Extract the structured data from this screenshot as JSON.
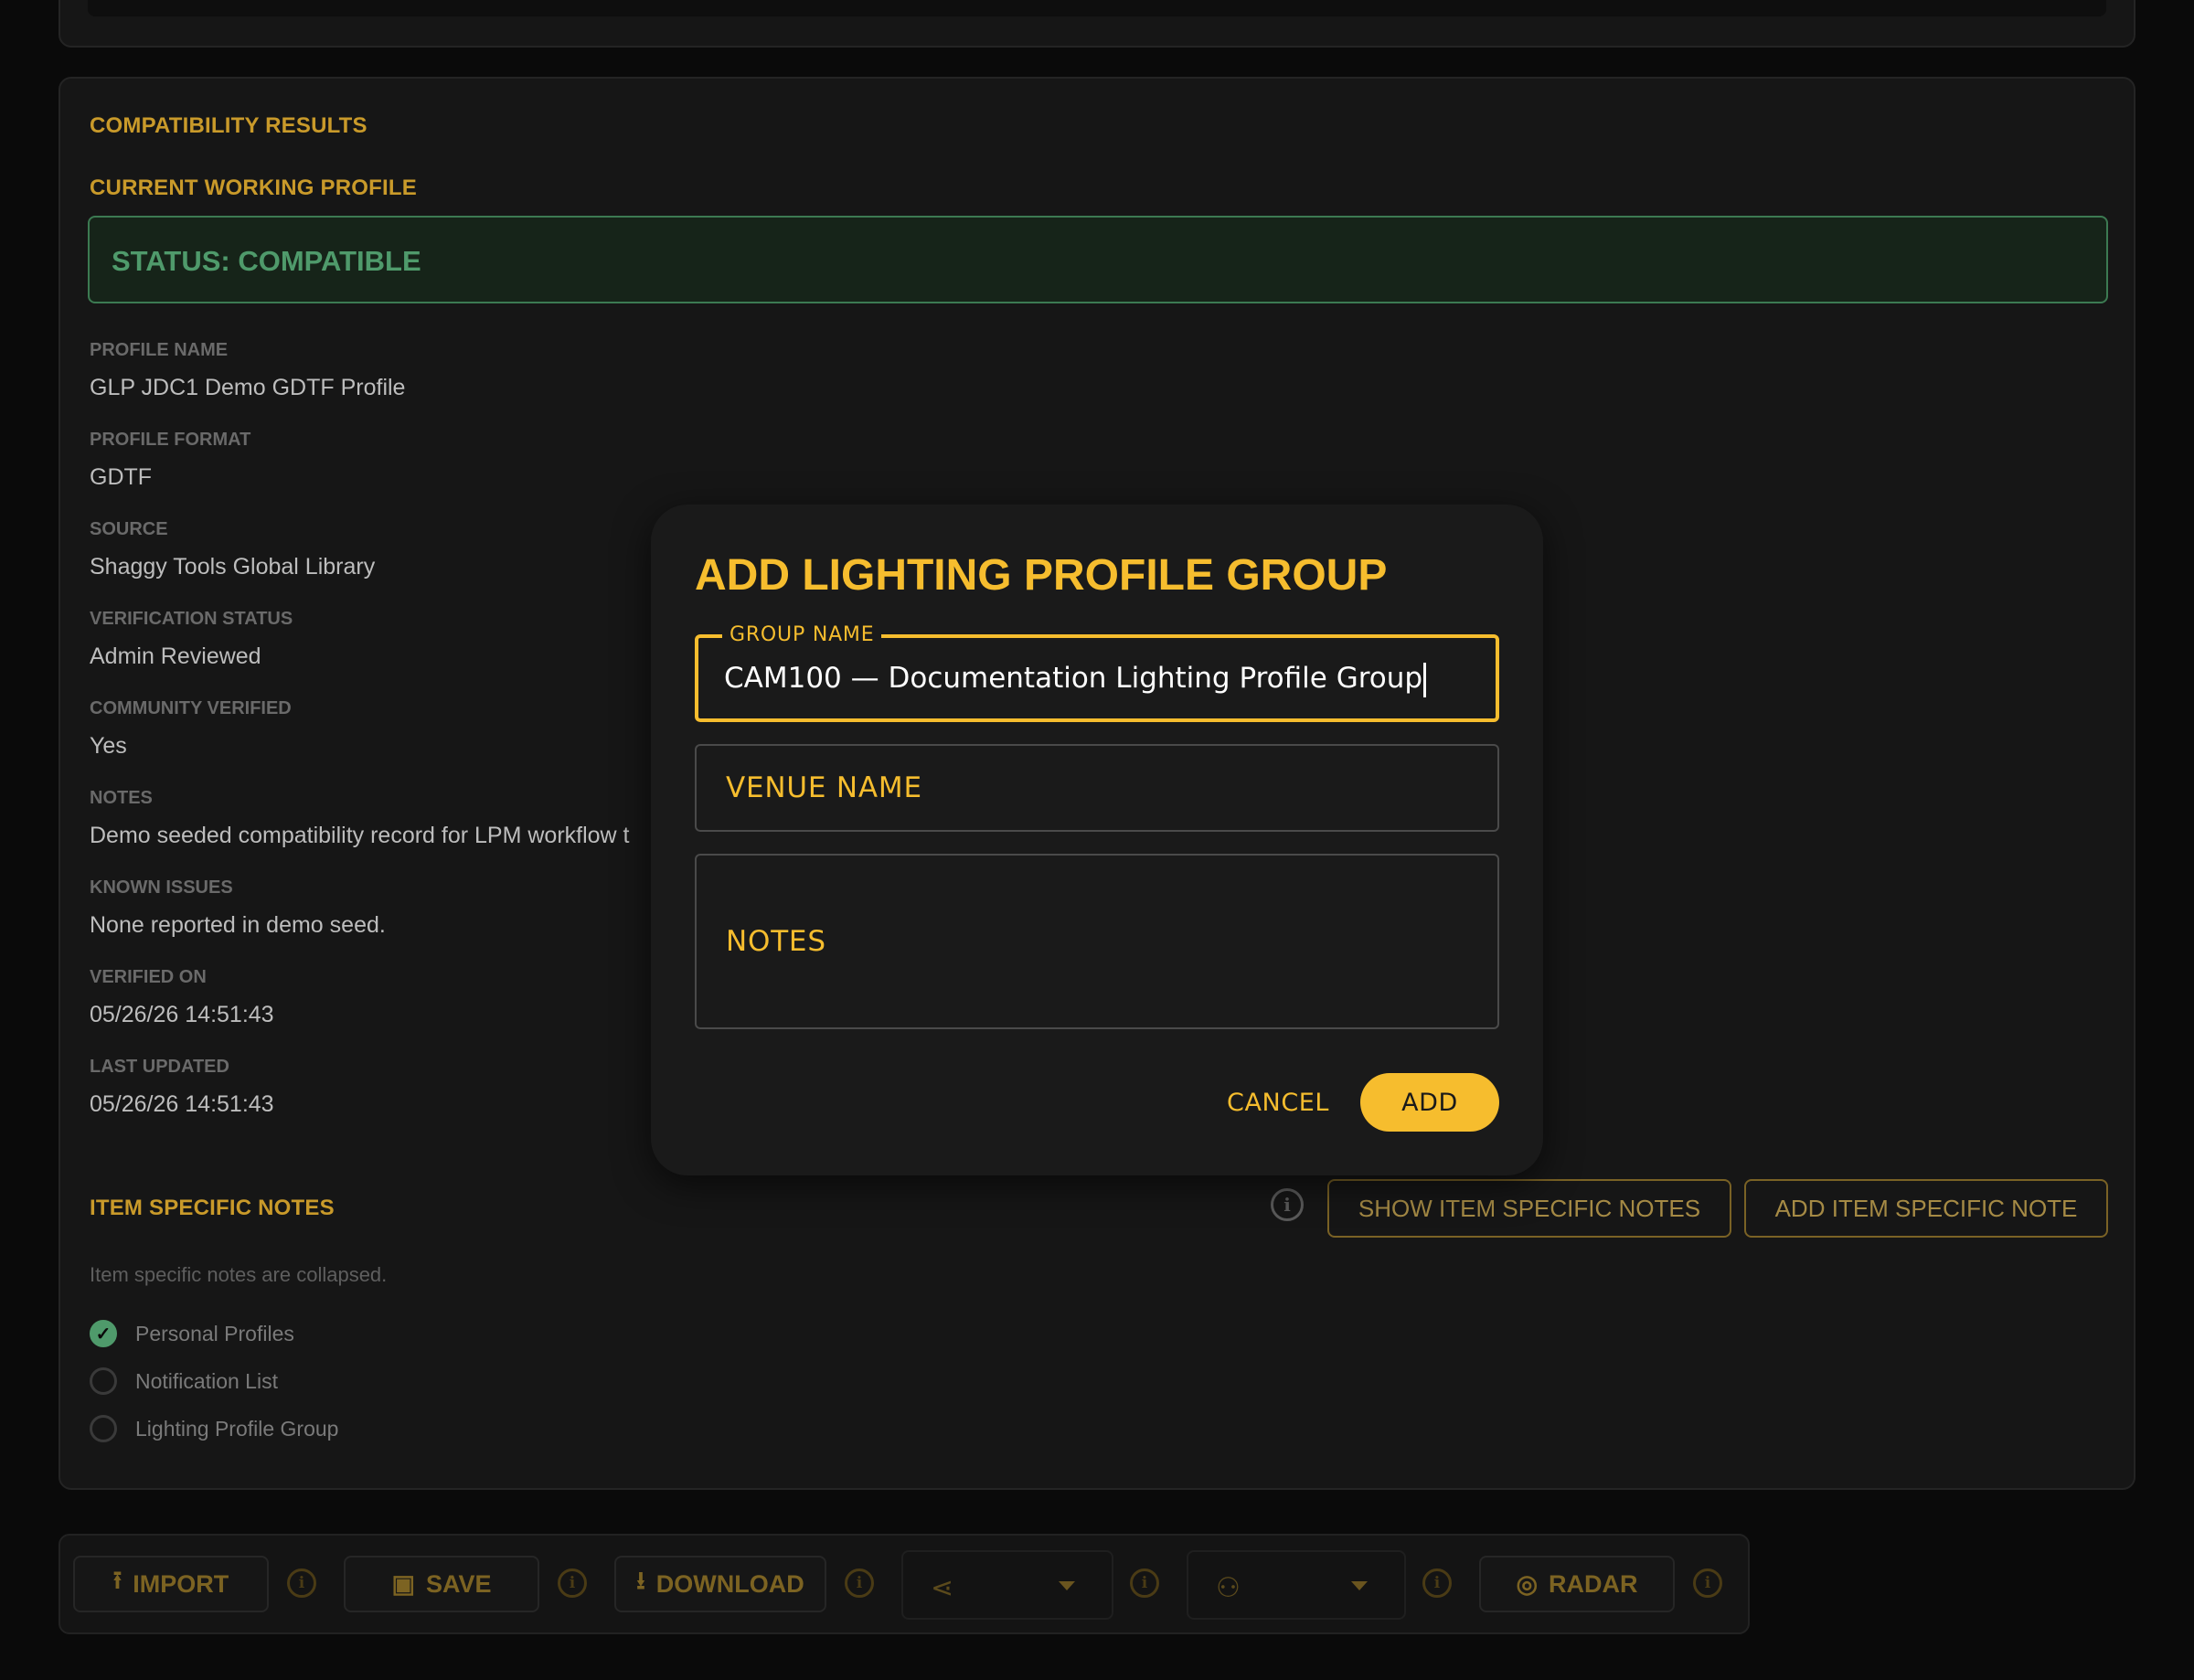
{
  "results": {
    "title": "COMPATIBILITY RESULTS",
    "working_profile_title": "CURRENT WORKING PROFILE",
    "status": "STATUS: COMPATIBLE",
    "fields": [
      {
        "label": "PROFILE NAME",
        "value": "GLP JDC1 Demo GDTF Profile"
      },
      {
        "label": "PROFILE FORMAT",
        "value": "GDTF"
      },
      {
        "label": "SOURCE",
        "value": "Shaggy Tools Global Library"
      },
      {
        "label": "VERIFICATION STATUS",
        "value": "Admin Reviewed"
      },
      {
        "label": "COMMUNITY VERIFIED",
        "value": "Yes"
      },
      {
        "label": "NOTES",
        "value": "Demo seeded compatibility record for LPM workflow t"
      },
      {
        "label": "KNOWN ISSUES",
        "value": "None reported in demo seed."
      },
      {
        "label": "VERIFIED ON",
        "value": "05/26/26 14:51:43"
      },
      {
        "label": "LAST UPDATED",
        "value": "05/26/26 14:51:43"
      }
    ],
    "item_notes": {
      "title": "ITEM SPECIFIC NOTES",
      "collapsed_text": "Item specific notes are collapsed.",
      "show_button": "SHOW ITEM SPECIFIC NOTES",
      "add_button": "ADD ITEM SPECIFIC NOTE"
    },
    "checklist": [
      {
        "label": "Personal Profiles",
        "checked": true
      },
      {
        "label": "Notification List",
        "checked": false
      },
      {
        "label": "Lighting Profile Group",
        "checked": false
      }
    ]
  },
  "toolbar": {
    "import": "IMPORT",
    "save": "SAVE",
    "download": "DOWNLOAD",
    "radar": "RADAR"
  },
  "dialog": {
    "title": "ADD LIGHTING PROFILE GROUP",
    "group_name_label": "GROUP NAME",
    "group_name_value": "CAM100 — Documentation Lighting Profile Group",
    "venue_placeholder": "VENUE NAME",
    "notes_placeholder": "NOTES",
    "cancel": "CANCEL",
    "add": "ADD"
  },
  "colors": {
    "accent": "#f6bd2e",
    "status_green": "#4f9a6b",
    "background": "#0a0a0a"
  }
}
